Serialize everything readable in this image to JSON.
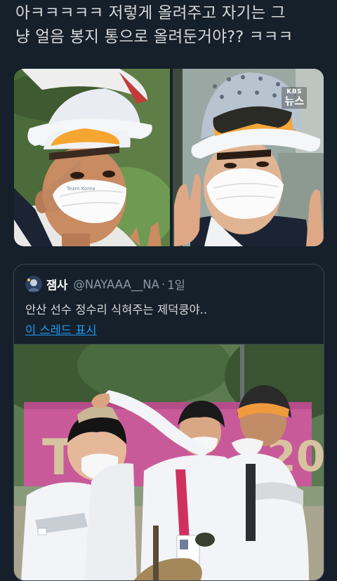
{
  "tweet": {
    "text": "아ㅋㅋㅋㅋㅋ 저렇게 올려주고 자기는 그\n냥 얼음 봉지 통으로 올려둔거야?? ㅋㅋㅋ",
    "media": {
      "left_photo": {
        "icon": "archer-portrait-photo"
      },
      "right_photo": {
        "icon": "archer-portrait-photo",
        "watermark_top": "KBS",
        "watermark_bottom": "뉴스"
      }
    }
  },
  "quoted_tweet": {
    "author_name": "잼사",
    "author_handle": "@NAYAAA__NA",
    "separator": "·",
    "time": "1일",
    "text": "안산 선수 정수리 식혀주는 제덕쿵야..",
    "thread_link": "이 스레드 표시",
    "media": {
      "icon": "archery-team-photo"
    }
  },
  "colors": {
    "background": "#15202b",
    "text": "#d9d9d9",
    "secondary": "#8b98a5",
    "link": "#1d9bf0",
    "border": "#38444d"
  }
}
